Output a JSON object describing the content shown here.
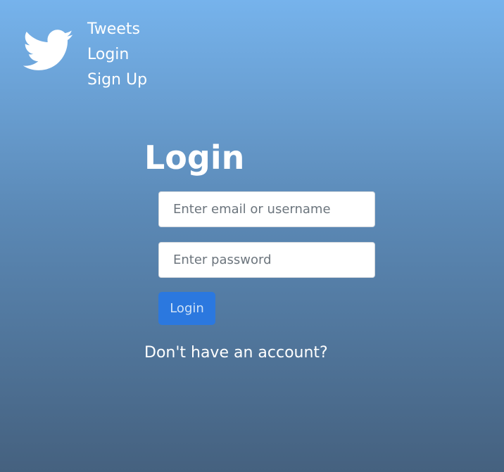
{
  "header": {
    "logo_icon": "twitter-bird-icon",
    "nav_items": [
      {
        "label": "Tweets"
      },
      {
        "label": "Login"
      },
      {
        "label": "Sign Up"
      }
    ]
  },
  "form": {
    "title": "Login",
    "email": {
      "placeholder": "Enter email or username",
      "value": ""
    },
    "password": {
      "placeholder": "Enter password",
      "value": ""
    },
    "submit_label": "Login",
    "signup_prompt": "Don't have an account?"
  },
  "colors": {
    "background_top": "#76b3ec",
    "background_bottom": "#45617f",
    "button": "#2b78df",
    "text": "#ffffff"
  }
}
